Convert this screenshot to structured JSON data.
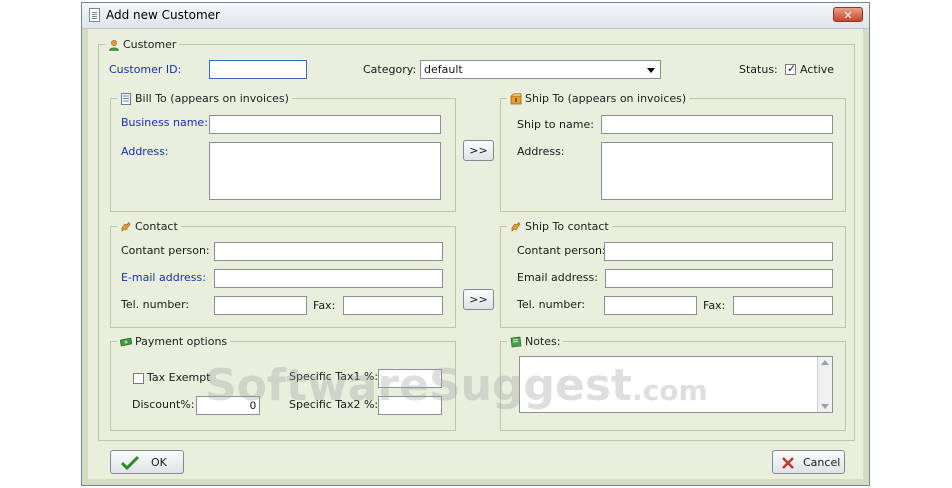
{
  "window": {
    "title": "Add new Customer",
    "close_label": "✕"
  },
  "customer": {
    "legend": "Customer",
    "id_label": "Customer ID:",
    "id_value": "",
    "category_label": "Category:",
    "category_value": "default",
    "status_label": "Status:",
    "active_label": "Active",
    "active_checked": true
  },
  "bill_to": {
    "legend": "Bill To (appears on invoices)",
    "business_label": "Business name:",
    "address_label": "Address:"
  },
  "ship_to": {
    "legend": "Ship To (appears on invoices)",
    "name_label": "Ship to name:",
    "address_label": "Address:"
  },
  "copy_button_label": ">>",
  "contact": {
    "legend": "Contact",
    "person_label": "Contant person:",
    "email_label": "E-mail address:",
    "tel_label": "Tel. number:",
    "fax_label": "Fax:"
  },
  "ship_contact": {
    "legend": "Ship To contact",
    "person_label": "Contant person:",
    "email_label": "Email address:",
    "tel_label": "Tel. number:",
    "fax_label": "Fax:"
  },
  "payment": {
    "legend": "Payment options",
    "tax_exempt_label": "Tax Exempt",
    "discount_label": "Discount%:",
    "discount_value": "0",
    "tax1_label": "Specific Tax1 %:",
    "tax2_label": "Specific Tax2 %:"
  },
  "notes": {
    "legend": "Notes:"
  },
  "buttons": {
    "ok": "OK",
    "cancel": "Cancel"
  },
  "watermark": {
    "main": "SoftwareSuggest",
    "suffix": ".com"
  },
  "colors": {
    "label_required": "#1a2fb5",
    "dialog_bg": "#e9eedd",
    "ok_check": "#2e8b2e",
    "cancel_x": "#c0392b"
  }
}
